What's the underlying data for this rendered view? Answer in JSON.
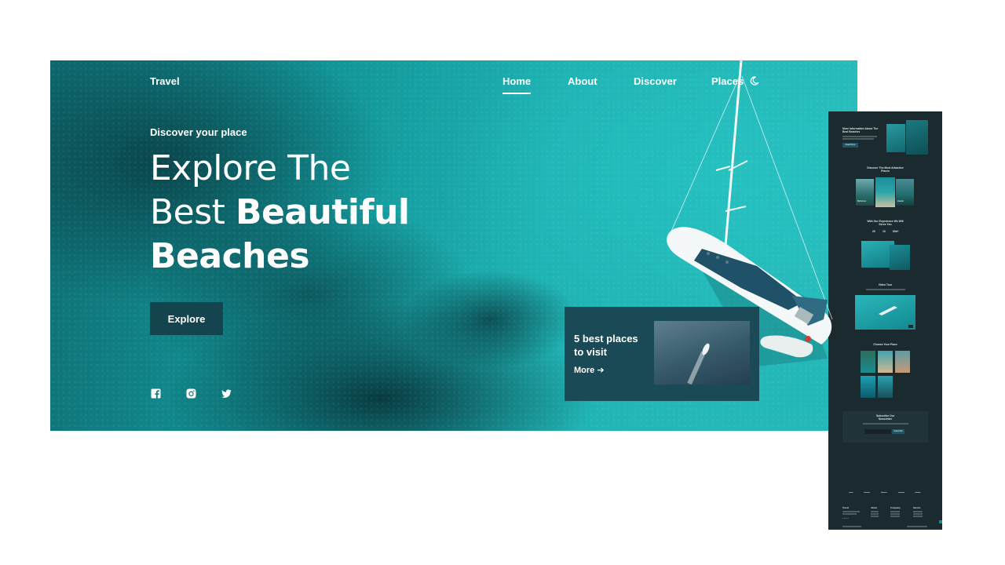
{
  "nav": {
    "brand": "Travel",
    "links": [
      "Home",
      "About",
      "Discover",
      "Places"
    ]
  },
  "hero": {
    "tagline": "Discover your place",
    "headline_line1": "Explore The",
    "headline_line2_light": "Best",
    "headline_line2_bold": "Beautiful",
    "headline_line3_bold": "Beaches",
    "explore_label": "Explore",
    "socials": [
      "facebook-icon",
      "instagram-icon",
      "twitter-icon"
    ]
  },
  "card": {
    "title": "5 best places to visit",
    "more_label": "More"
  },
  "mobile": {
    "info_title": "More Information About The Best Beaches",
    "info_button": "Read More",
    "discover_title": "Discover The Most Attractive Places",
    "discover_places": [
      "Bahamas",
      "",
      "Hawaii"
    ],
    "experience_title": "With Our Experience We Will Serve You",
    "stats": [
      "20",
      "10",
      "60k+"
    ],
    "video_title": "Video Tour",
    "places_title": "Choose Your Place",
    "subscribe_title": "Subscribe Our Newsletter",
    "subscribe_button": "Subscribe",
    "footer_headers": [
      "Travel",
      "About",
      "Company",
      "Secure"
    ]
  },
  "colors": {
    "card_bg": "#1a4a55",
    "button_bg": "#14444d",
    "mobile_bg": "#1b2a2e"
  }
}
